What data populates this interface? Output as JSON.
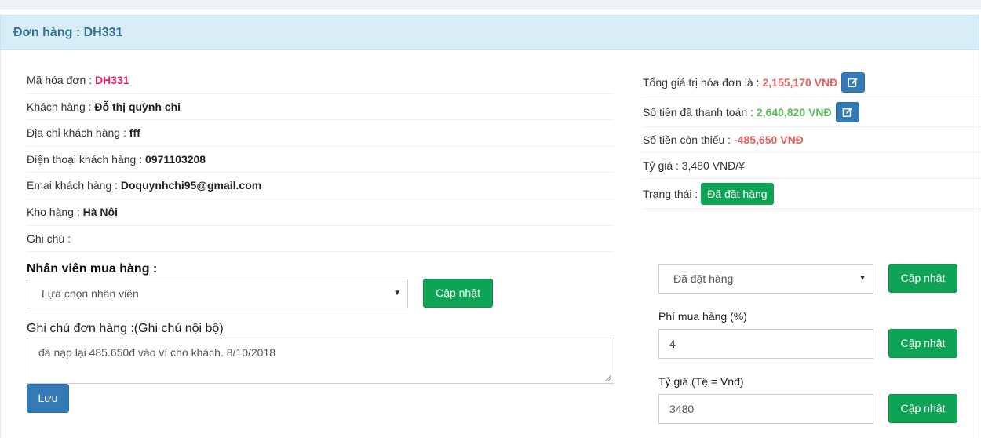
{
  "header": {
    "title": "Đơn hàng : DH331"
  },
  "order_info": [
    {
      "label": "Mã hóa đơn : ",
      "value": "DH331"
    },
    {
      "label": "Khách hàng : ",
      "value": "Đỗ thị quỳnh chi"
    },
    {
      "label": "Địa chỉ khách hàng : ",
      "value": "fff"
    },
    {
      "label": "Điện thoại khách hàng : ",
      "value": "0971103208"
    },
    {
      "label": "Emai khách hàng : ",
      "value": "Doquynhchi95@gmail.com"
    },
    {
      "label": "Kho hàng : ",
      "value": "Hà Nội"
    },
    {
      "label": "Ghi chú : ",
      "value": ""
    }
  ],
  "summary": {
    "total_label": "Tổng giá trị hóa đơn là : ",
    "total_value": "2,155,170 VNĐ",
    "paid_label": "Số tiền đã thanh toán : ",
    "paid_value": "2,640,820 VNĐ",
    "remaining_label": "Số tiền còn thiếu : ",
    "remaining_value": "-485,650 VNĐ",
    "rate_text": "Tỷ giá : 3,480 VNĐ/¥",
    "status_label": "Trạng thái : ",
    "status_value": "Đã đặt hàng"
  },
  "staff": {
    "title": "Nhân viên mua hàng :",
    "select_value": "Lựa chọn nhân viên",
    "update_label": "Cập nhật"
  },
  "internal_note": {
    "label": "Ghi chú đơn hàng :(Ghi chú nội bộ)",
    "value": "đã nạp lại 485.650đ vào ví cho khách. 8/10/2018",
    "save_label": "Lưu"
  },
  "right_form": {
    "status_select": "Đã đặt hàng",
    "status_update_label": "Cập nhật",
    "fee_label": "Phí mua hàng (%)",
    "fee_value": "4",
    "fee_update_label": "Cập nhật",
    "rate_label": "Tỷ giá (Tệ = Vnđ)",
    "rate_value": "3480",
    "rate_update_label": "Cập nhật"
  },
  "colors": {
    "accent_green": "#0fa355",
    "accent_blue": "#337ab7",
    "heading_bg": "#d9edf7",
    "heading_text": "#31708f",
    "code_pink": "#e91e63",
    "amount_red": "#d9534f",
    "amount_green": "#5cb85c"
  },
  "icons": {
    "edit": "edit-icon",
    "caret": "caret-down-icon"
  }
}
